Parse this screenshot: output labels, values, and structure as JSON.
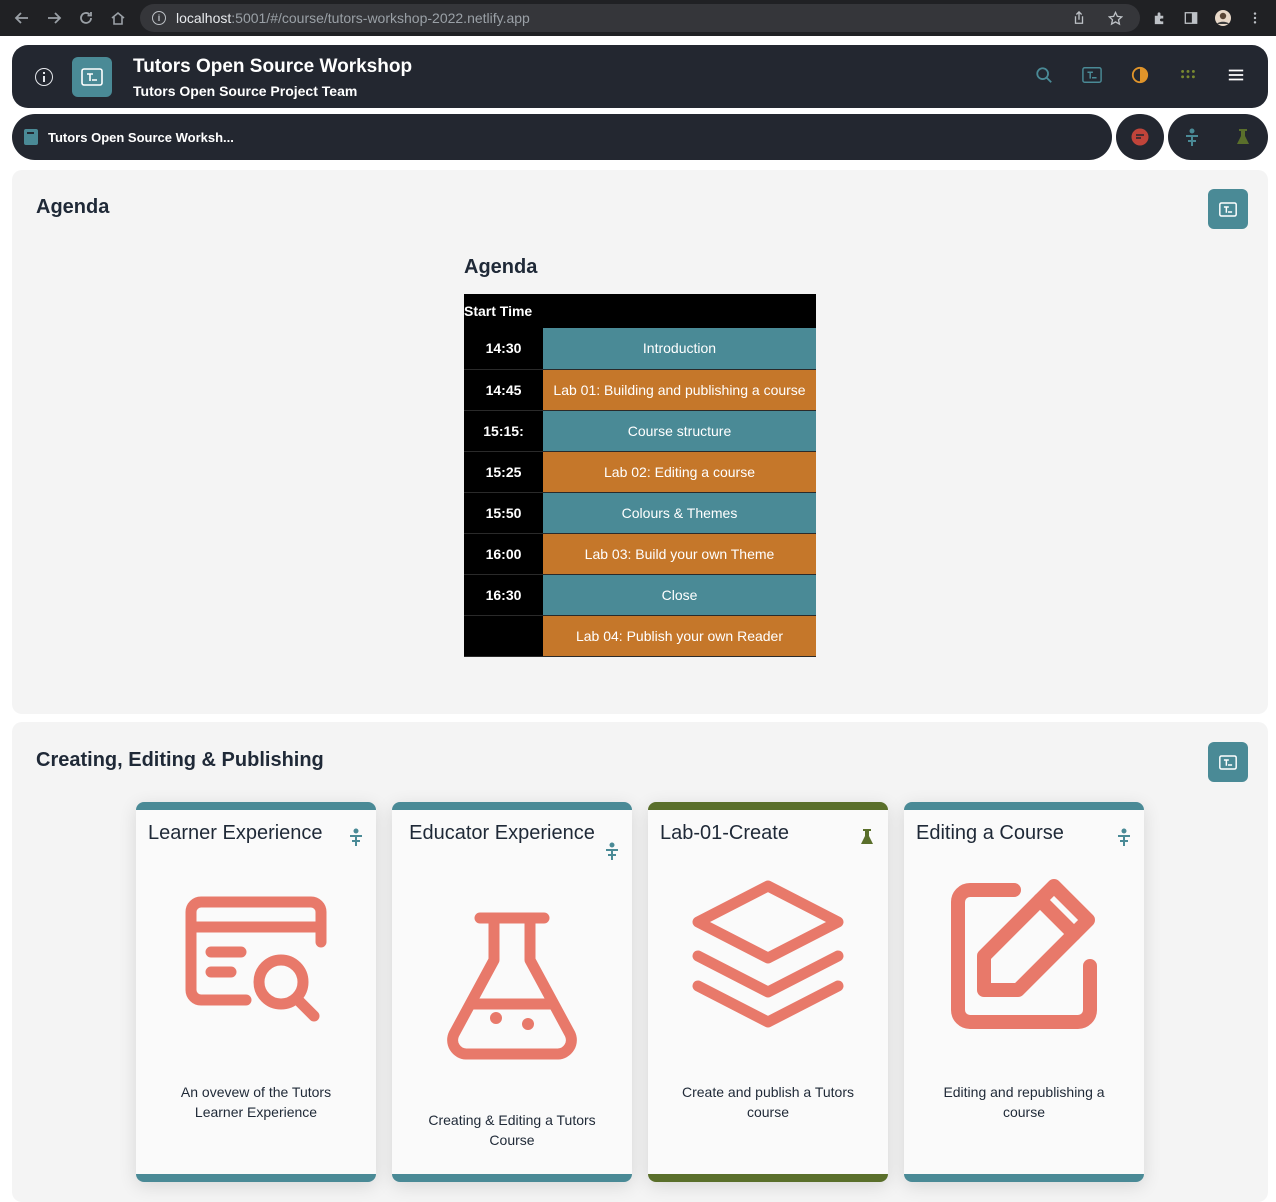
{
  "browser": {
    "url_host": "localhost",
    "url_rest": ":5001/#/course/tutors-workshop-2022.netlify.app"
  },
  "header": {
    "title": "Tutors Open Source Workshop",
    "subtitle": "Tutors Open Source Project Team"
  },
  "breadcrumb": {
    "label": "Tutors Open Source Worksh..."
  },
  "agenda_section": {
    "title": "Agenda",
    "heading": "Agenda",
    "column_header": "Start Time",
    "rows": [
      {
        "time": "14:30",
        "activity": "Introduction"
      },
      {
        "time": "14:45",
        "activity": "Lab 01: Building and publishing a course"
      },
      {
        "time": "15:15:",
        "activity": "Course structure"
      },
      {
        "time": "15:25",
        "activity": "Lab 02: Editing a course"
      },
      {
        "time": "15:50",
        "activity": "Colours & Themes"
      },
      {
        "time": "16:00",
        "activity": "Lab 03: Build your own Theme"
      },
      {
        "time": "16:30",
        "activity": "Close"
      },
      {
        "time": "",
        "activity": "Lab 04: Publish your own Reader"
      }
    ]
  },
  "creating_section": {
    "title": "Creating, Editing & Publishing",
    "cards": [
      {
        "title": "Learner Experience",
        "description": "An ovevew of the Tutors Learner Experience",
        "icon": "file-search-icon",
        "badge": "talk-icon"
      },
      {
        "title": "Educator Experience",
        "description": "Creating & Editing a Tutors Course",
        "icon": "flask-icon",
        "badge": "talk-icon"
      },
      {
        "title": "Lab-01-Create",
        "description": "Create and publish a Tutors course",
        "icon": "layers-icon",
        "badge": "lab-icon"
      },
      {
        "title": "Editing a Course",
        "description": "Editing and republishing a course",
        "icon": "edit-icon",
        "badge": "talk-icon"
      }
    ]
  },
  "colors": {
    "primary": "#4a8a96",
    "secondary": "#c5772a",
    "lab": "#5a6f2b",
    "icon": "#e8796a",
    "header_bg": "#232730"
  }
}
